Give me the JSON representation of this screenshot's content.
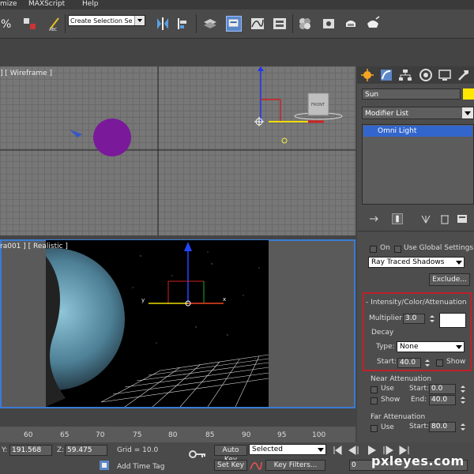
{
  "menu": {
    "items": [
      "mize",
      "MAXScript",
      "Help"
    ]
  },
  "toolbar": {
    "selection_set_placeholder": "Create Selection Se"
  },
  "viewports": {
    "top_label": "] [ Wireframe ]",
    "persp_label": "ra001 ] [ Realistic ]",
    "gizmo_front_label": "FRONT",
    "axis_x": "x",
    "axis_y": "y"
  },
  "command_panel": {
    "object_name": "Sun",
    "object_color": "#ffe800",
    "modifier_list": "Modifier List",
    "stack_item": "Omni Light"
  },
  "shadows": {
    "on_label": "On",
    "use_global_label": "Use Global Settings",
    "type": "Ray Traced Shadows",
    "exclude_label": "Exclude..."
  },
  "intensity": {
    "header": "Intensity/Color/Attenuation",
    "multiplier_label": "Multiplier:",
    "multiplier_value": "3.0",
    "color": "#ffffff",
    "decay_label": "Decay",
    "type_label": "Type:",
    "type_value": "None",
    "start_label": "Start:",
    "start_value": "40.0",
    "show_label": "Show"
  },
  "near_attenuation": {
    "label": "Near Attenuation",
    "use_label": "Use",
    "show_label": "Show",
    "start_label": "Start:",
    "start_value": "0.0",
    "end_label": "End:",
    "end_value": "40.0"
  },
  "far_attenuation": {
    "label": "Far Attenuation",
    "use_label": "Use",
    "start_label": "Start:",
    "start_value": "80.0"
  },
  "timeline": {
    "ticks": [
      "60",
      "65",
      "70",
      "75",
      "80",
      "85",
      "90",
      "95",
      "100"
    ]
  },
  "status": {
    "y_label": "Y:",
    "y_value": "191.568",
    "z_label": "Z:",
    "z_value": "59.475",
    "grid": "Grid = 10.0",
    "add_time_tag": "Add Time Tag",
    "auto_key": "Auto Key",
    "set_key": "Set Key",
    "key_mode": "Selected",
    "key_filters": "Key Filters...",
    "frame_value": "0"
  },
  "watermark": "pxleyes.com",
  "colors": {
    "accent": "#3a7bd5",
    "highlight_box": "#c0202a",
    "selection": "#3366cc"
  }
}
